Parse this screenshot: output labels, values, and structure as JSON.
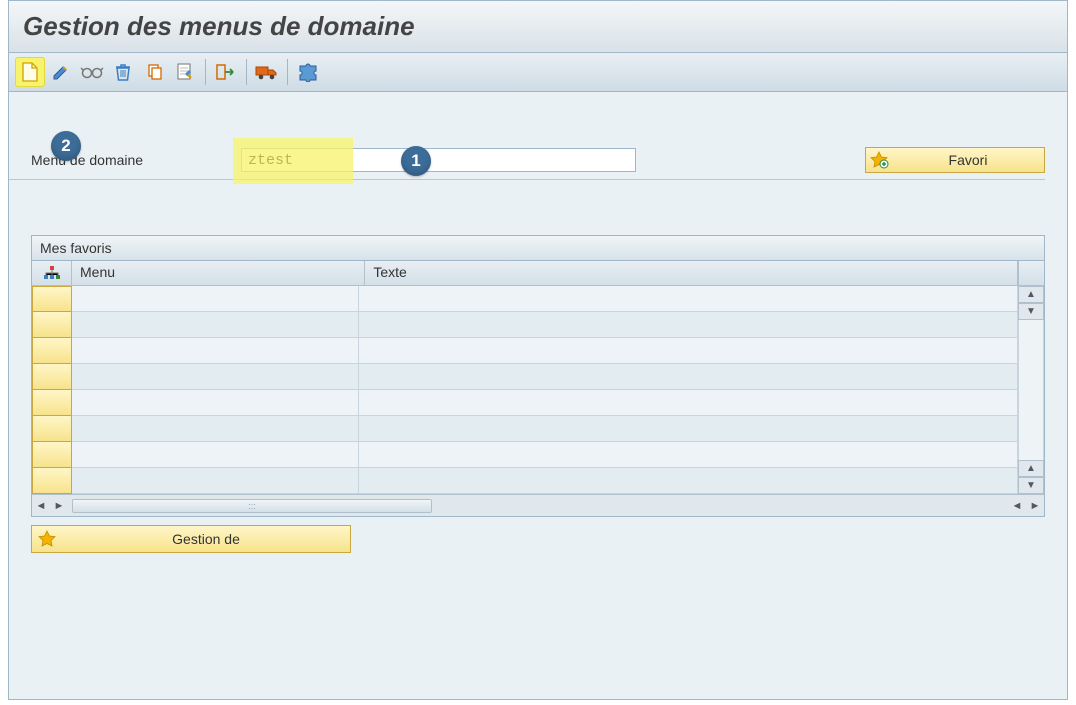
{
  "title": "Gestion des menus de domaine",
  "toolbar": {
    "icons": [
      "new-page",
      "pencil",
      "glasses",
      "trash",
      "copy",
      "note-edit",
      "nav-exit",
      "truck",
      "puzzle"
    ]
  },
  "step_labels": {
    "one": "1",
    "two": "2"
  },
  "field": {
    "label": "Menu de domaine",
    "value": "ztest"
  },
  "favori_button": {
    "label": "Favori"
  },
  "favorites": {
    "title": "Mes favoris",
    "columns": {
      "menu": "Menu",
      "texte": "Texte"
    },
    "rows": [
      "",
      "",
      "",
      "",
      "",
      "",
      "",
      ""
    ]
  },
  "gestion_button": {
    "label": "Gestion de"
  }
}
